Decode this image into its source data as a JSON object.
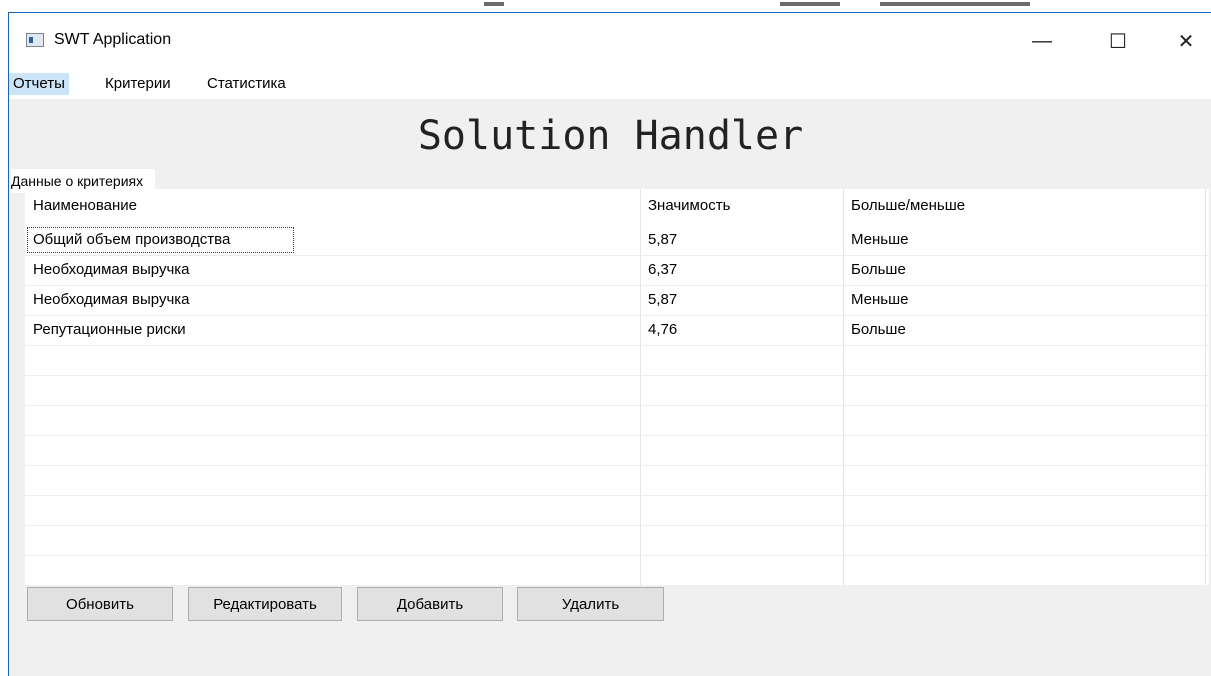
{
  "window": {
    "title": "SWT Application",
    "controls": {
      "minimize": "—",
      "maximize": "☐",
      "close": "✕"
    }
  },
  "menu": [
    "Отчеты",
    "Критерии",
    "Статистика"
  ],
  "heading": "Solution Handler",
  "group_label": "Данные о критериях",
  "table": {
    "columns": [
      "Наименование",
      "Значимость",
      "Больше/меньше"
    ],
    "rows": [
      [
        "Общий объем производства",
        "5,87",
        "Меньше"
      ],
      [
        "Необходимая выручка",
        "6,37",
        "Больше"
      ],
      [
        "Необходимая выручка",
        "5,87",
        "Меньше"
      ],
      [
        "Репутационные риски",
        "4,76",
        "Больше"
      ]
    ]
  },
  "buttons": {
    "refresh": "Обновить",
    "edit": "Редактировать",
    "add": "Добавить",
    "delete": "Удалить"
  }
}
